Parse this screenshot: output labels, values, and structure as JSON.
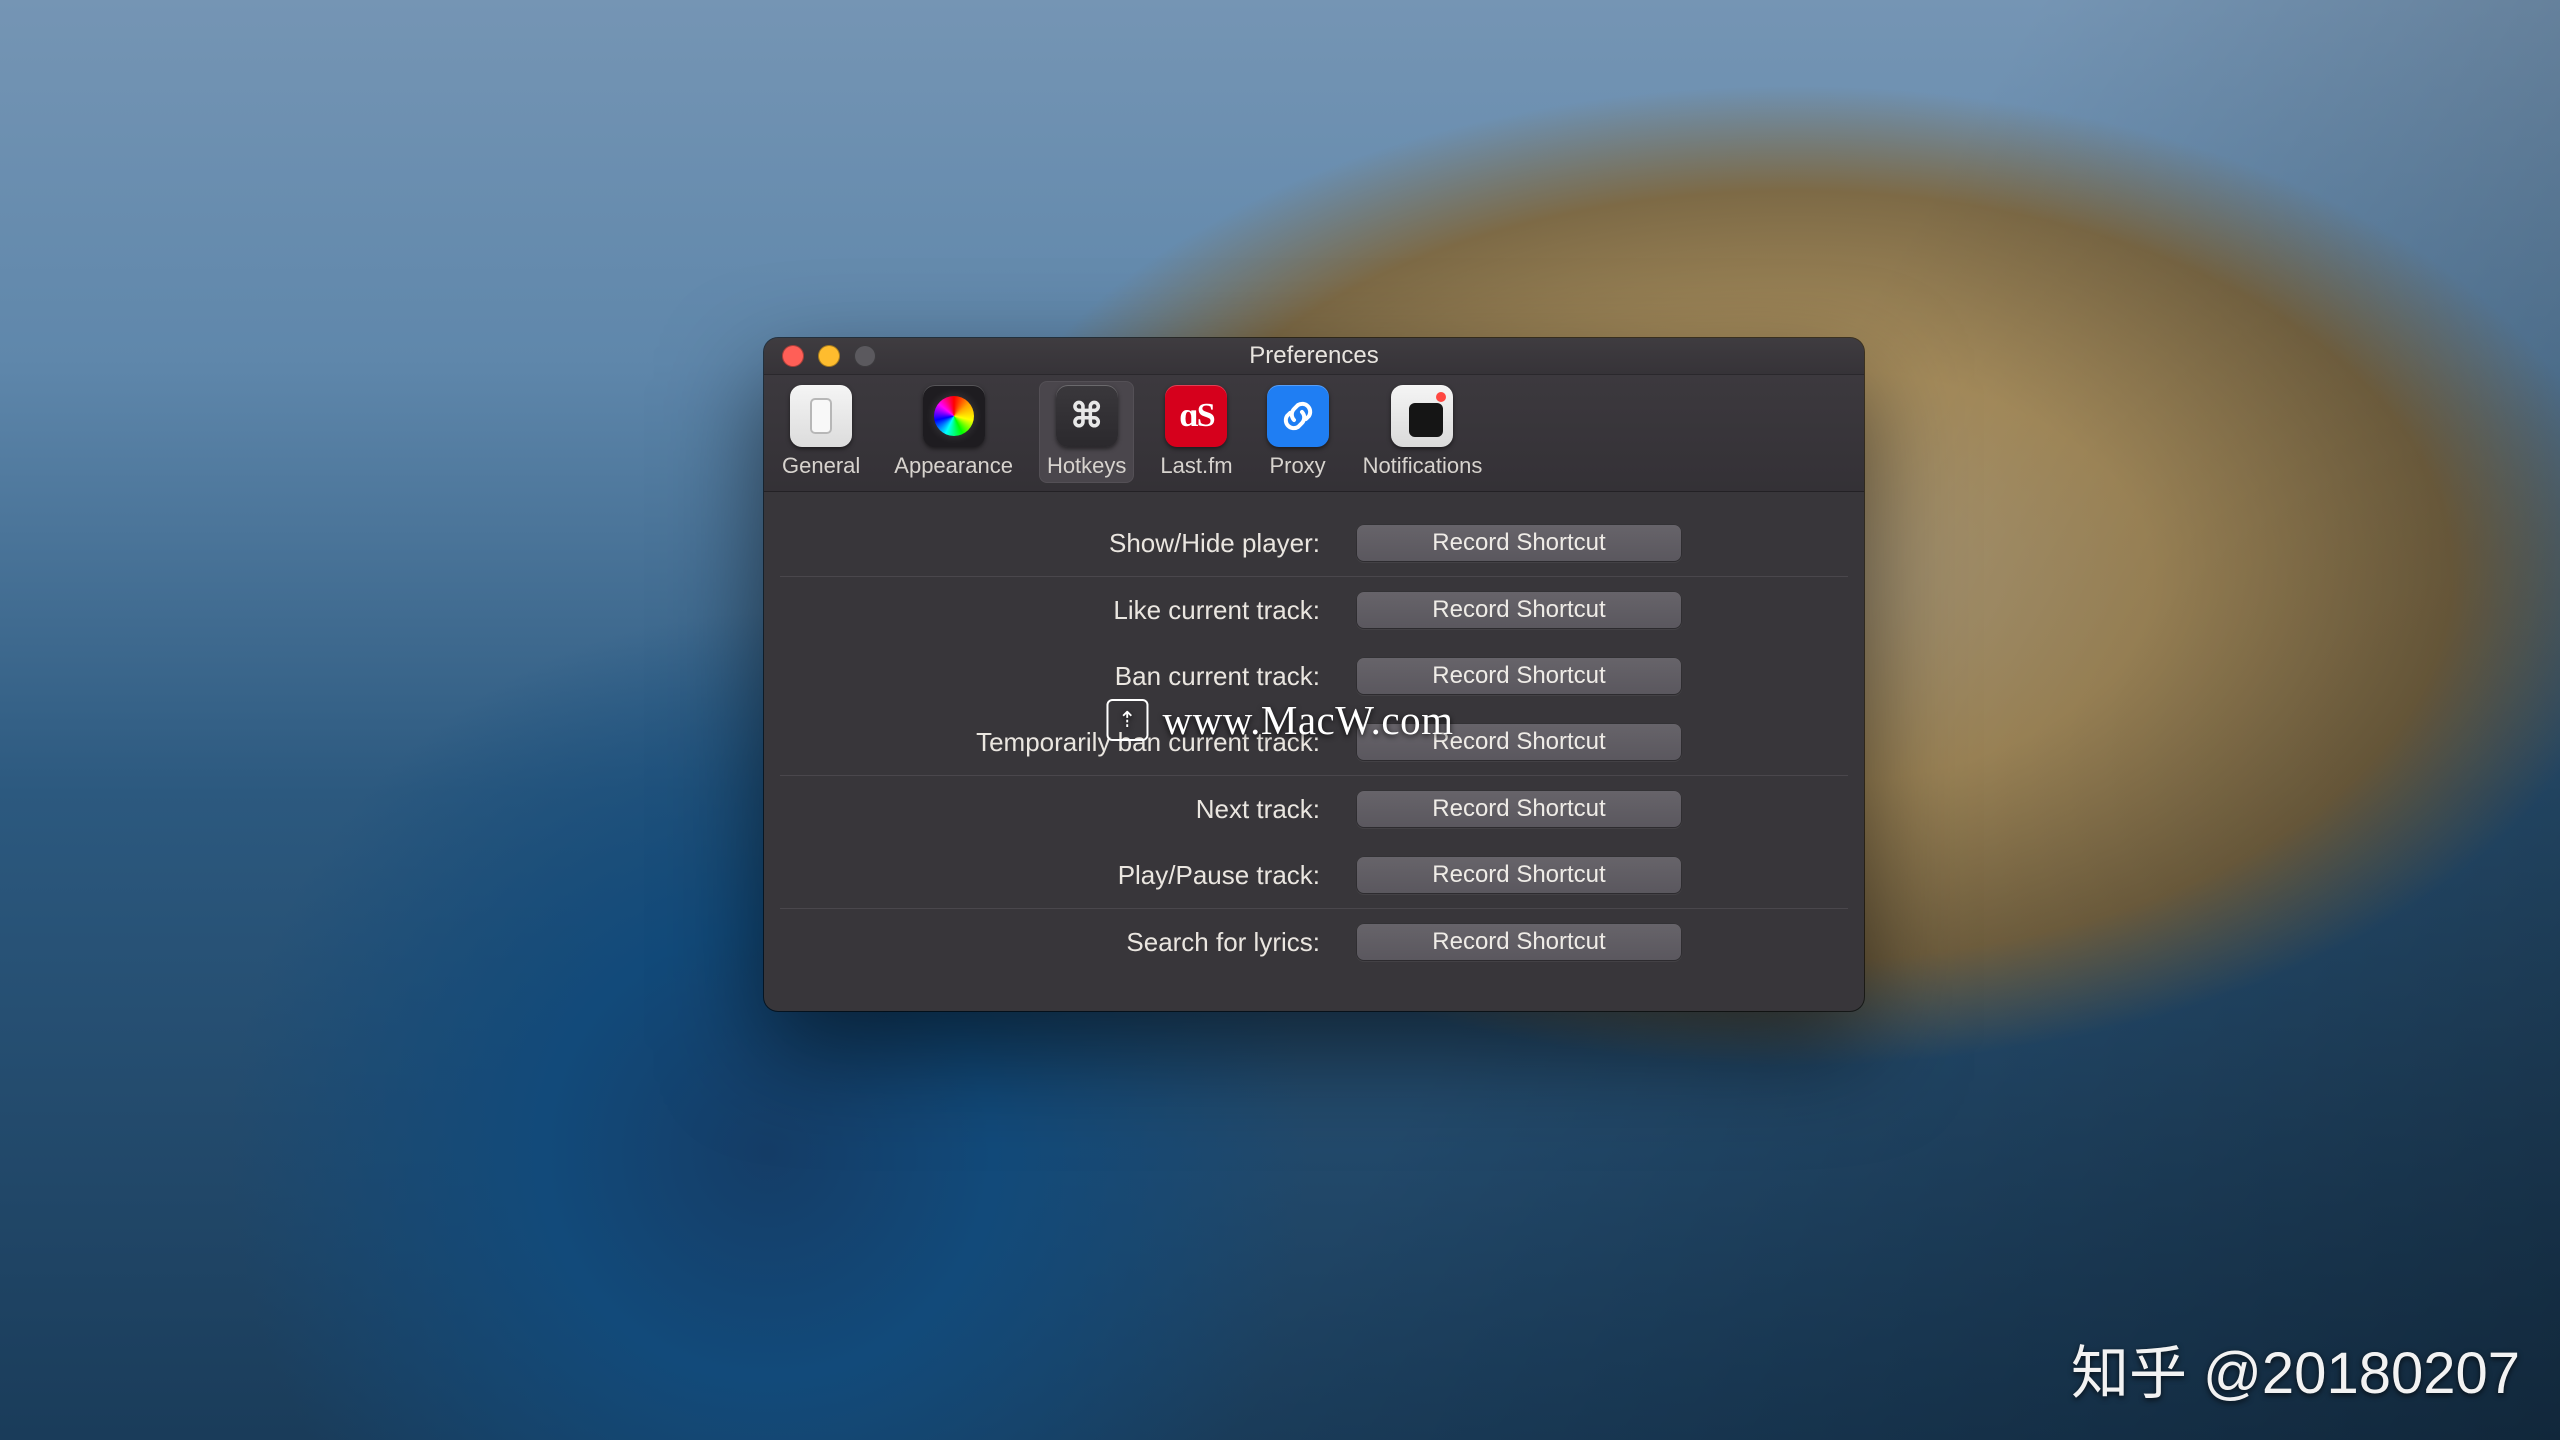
{
  "window": {
    "title": "Preferences"
  },
  "toolbar": {
    "items": [
      {
        "label": "General"
      },
      {
        "label": "Appearance"
      },
      {
        "label": "Hotkeys"
      },
      {
        "label": "Last.fm"
      },
      {
        "label": "Proxy"
      },
      {
        "label": "Notifications"
      }
    ],
    "selected_index": 2,
    "hotkeys_glyph": "⌘",
    "lastfm_glyph": "ɑS"
  },
  "hotkeys": {
    "record_button_label": "Record Shortcut",
    "sections": [
      {
        "rows": [
          {
            "label": "Show/Hide player:"
          }
        ]
      },
      {
        "rows": [
          {
            "label": "Like current track:"
          },
          {
            "label": "Ban current track:"
          },
          {
            "label": "Temporarily ban current track:"
          }
        ]
      },
      {
        "rows": [
          {
            "label": "Next track:"
          },
          {
            "label": "Play/Pause track:"
          }
        ]
      },
      {
        "rows": [
          {
            "label": "Search for lyrics:"
          }
        ]
      }
    ]
  },
  "watermark": {
    "center_badge_glyph": "⇡",
    "center": "www.MacW.com",
    "corner": "知乎 @20180207"
  }
}
